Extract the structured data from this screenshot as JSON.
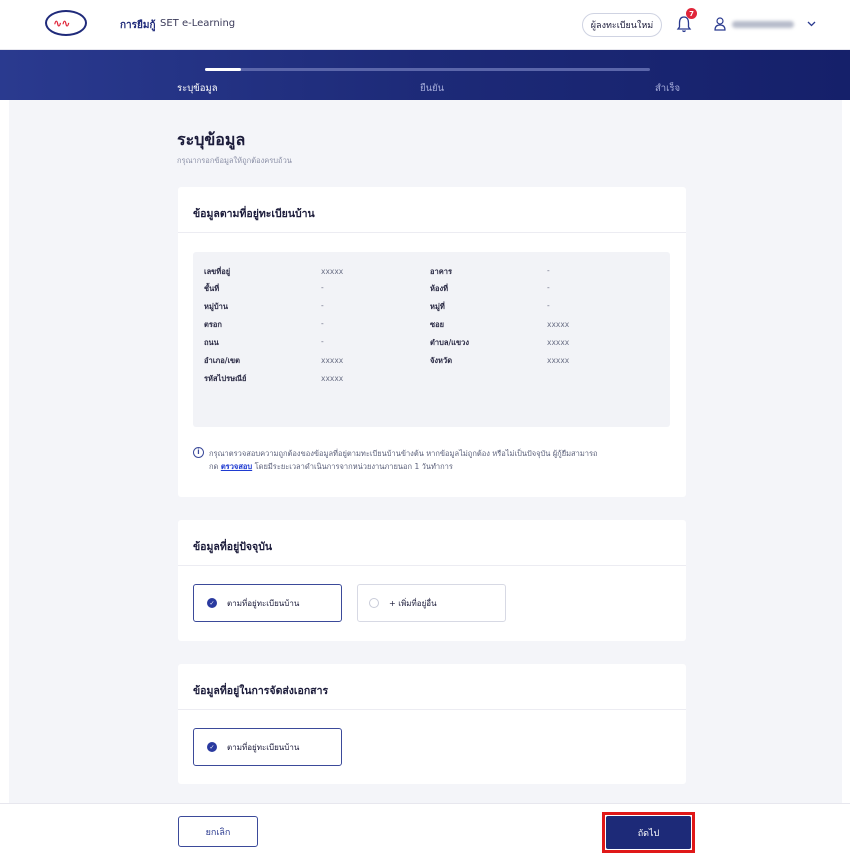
{
  "nav": {
    "home": "การยืมกู้",
    "elearning": "SET e-Learning",
    "register": "ผู้ลงทะเบียนใหม่",
    "notification_count": "7"
  },
  "stepper": {
    "steps": [
      "ระบุข้อมูล",
      "ยืนยัน",
      "สำเร็จ"
    ],
    "active_step": 1
  },
  "page": {
    "title": "ระบุข้อมูล",
    "subtitle": "กรุณากรอกข้อมูลให้ถูกต้องครบถ้วน"
  },
  "registered_address": {
    "title": "ข้อมูลตามที่อยู่ทะเบียนบ้าน",
    "fields": [
      {
        "label": "เลขที่อยู่",
        "value": "xxxxx"
      },
      {
        "label": "อาคาร",
        "value": "-"
      },
      {
        "label": "ชั้นที่",
        "value": "-"
      },
      {
        "label": "ห้องที่",
        "value": "-"
      },
      {
        "label": "หมู่บ้าน",
        "value": "-"
      },
      {
        "label": "หมู่ที่",
        "value": "-"
      },
      {
        "label": "ตรอก",
        "value": "-"
      },
      {
        "label": "ซอย",
        "value": "xxxxx"
      },
      {
        "label": "ถนน",
        "value": "-"
      },
      {
        "label": "ตำบล/แขวง",
        "value": "xxxxx"
      },
      {
        "label": "อำเภอ/เขต",
        "value": "xxxxx"
      },
      {
        "label": "จังหวัด",
        "value": "xxxxx"
      },
      {
        "label": "รหัสไปรษณีย์",
        "value": "xxxxx"
      }
    ],
    "note_line1": "กรุณาตรวจสอบความถูกต้องของข้อมูลที่อยู่ตามทะเบียนบ้านข้างต้น หากข้อมูลไม่ถูกต้อง หรือไม่เป็นปัจจุบัน ผู้กู้ยืมสามารถ",
    "note_prefix": "กด",
    "note_link": "ตรวจสอบ",
    "note_suffix": "โดยมีระยะเวลาดำเนินการจากหน่วยงานภายนอก 1 วันทำการ"
  },
  "current_address": {
    "title": "ข้อมูลที่อยู่ปัจจุบัน",
    "option_selected": "ตามที่อยู่ทะเบียนบ้าน",
    "option_other": "+ เพิ่มที่อยู่อื่น"
  },
  "delivery_address": {
    "title": "ข้อมูลที่อยู่ในการจัดส่งเอกสาร",
    "option_selected": "ตามที่อยู่ทะเบียนบ้าน"
  },
  "footer": {
    "cancel": "ยกเลิก",
    "next": "ถัดไป"
  },
  "colors": {
    "primary": "#1d2a78",
    "highlight": "#e01818",
    "badge": "#e0263a"
  }
}
